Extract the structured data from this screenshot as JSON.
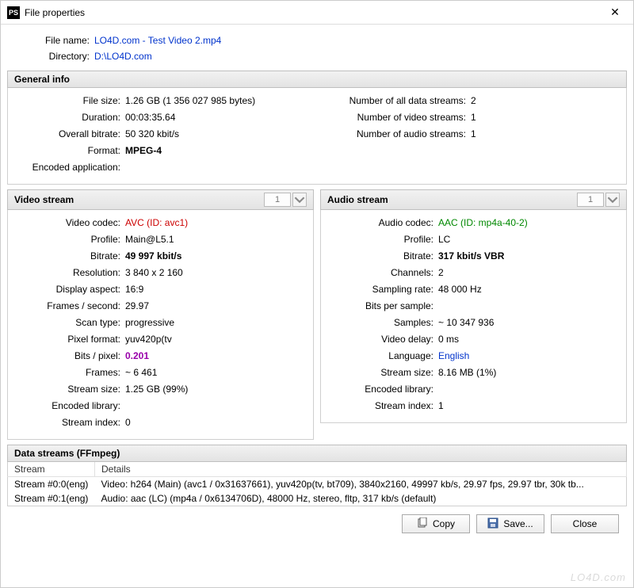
{
  "window": {
    "title": "File properties"
  },
  "file": {
    "lbl_name": "File name:",
    "name": "LO4D.com - Test Video 2.mp4",
    "lbl_dir": "Directory:",
    "dir": "D:\\LO4D.com"
  },
  "general": {
    "heading": "General info",
    "left": [
      {
        "k": "File size:",
        "v": "1.26 GB  (1 356 027 985 bytes)"
      },
      {
        "k": "Duration:",
        "v": "00:03:35.64"
      },
      {
        "k": "Overall bitrate:",
        "v": "50 320 kbit/s"
      },
      {
        "k": "Format:",
        "v": "MPEG-4",
        "bold": true
      },
      {
        "k": "Encoded application:",
        "v": ""
      }
    ],
    "right": [
      {
        "k": "Number of all data streams:",
        "v": "2"
      },
      {
        "k": "Number of video streams:",
        "v": "1"
      },
      {
        "k": "Number of audio streams:",
        "v": "1"
      }
    ]
  },
  "video": {
    "heading": "Video stream",
    "selector": "1",
    "rows": [
      {
        "k": "Video codec:",
        "v": "AVC (ID: avc1)",
        "cls": "red"
      },
      {
        "k": "Profile:",
        "v": "Main@L5.1"
      },
      {
        "k": "Bitrate:",
        "v": "49 997 kbit/s",
        "cls": "bold"
      },
      {
        "k": "Resolution:",
        "v": "3 840 x 2 160"
      },
      {
        "k": "Display aspect:",
        "v": "16:9"
      },
      {
        "k": "Frames / second:",
        "v": "29.97"
      },
      {
        "k": "Scan type:",
        "v": "progressive"
      },
      {
        "k": "Pixel format:",
        "v": "yuv420p(tv"
      },
      {
        "k": "Bits / pixel:",
        "v": "0.201",
        "cls": "purple bold"
      },
      {
        "k": "Frames:",
        "v": "~ 6 461"
      },
      {
        "k": "Stream size:",
        "v": "1.25 GB (99%)"
      },
      {
        "k": "Encoded library:",
        "v": ""
      },
      {
        "k": "Stream index:",
        "v": "0"
      }
    ]
  },
  "audio": {
    "heading": "Audio stream",
    "selector": "1",
    "rows": [
      {
        "k": "Audio codec:",
        "v": "AAC (ID: mp4a-40-2)",
        "cls": "green"
      },
      {
        "k": "Profile:",
        "v": "LC"
      },
      {
        "k": "Bitrate:",
        "v": "317 kbit/s  VBR",
        "cls": "bold"
      },
      {
        "k": "Channels:",
        "v": "2"
      },
      {
        "k": "Sampling rate:",
        "v": "48 000 Hz"
      },
      {
        "k": "Bits per sample:",
        "v": ""
      },
      {
        "k": "Samples:",
        "v": "~ 10 347 936"
      },
      {
        "k": "Video delay:",
        "v": "0 ms"
      },
      {
        "k": "Language:",
        "v": "English",
        "cls": "link"
      },
      {
        "k": "Stream size:",
        "v": "8.16 MB (1%)"
      },
      {
        "k": "Encoded library:",
        "v": ""
      },
      {
        "k": "Stream index:",
        "v": "1"
      }
    ]
  },
  "datastreams": {
    "heading": "Data streams   (FFmpeg)",
    "cols": [
      "Stream",
      "Details"
    ],
    "rows": [
      {
        "c0": "Stream #0:0(eng)",
        "c1": "Video: h264 (Main) (avc1 / 0x31637661), yuv420p(tv, bt709), 3840x2160, 49997 kb/s, 29.97 fps, 29.97 tbr, 30k tb..."
      },
      {
        "c0": "Stream #0:1(eng)",
        "c1": "Audio: aac (LC) (mp4a / 0x6134706D), 48000 Hz, stereo, fltp, 317 kb/s (default)"
      }
    ]
  },
  "buttons": {
    "copy": "Copy",
    "save": "Save...",
    "close": "Close"
  },
  "watermark": "LO4D.com"
}
